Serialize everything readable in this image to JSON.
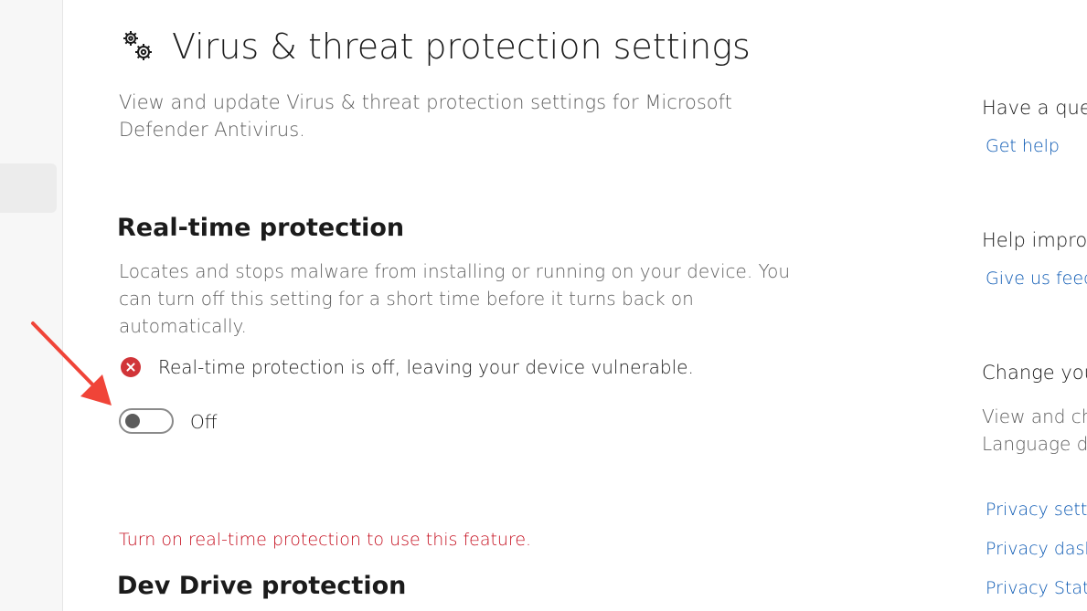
{
  "header": {
    "title": "Virus & threat protection settings",
    "description": "View and update Virus & threat protection settings for Microsoft Defender Antivirus.",
    "icon": "gears-icon"
  },
  "realtime": {
    "heading": "Real-time protection",
    "description": "Locates and stops malware from installing or running on your device. You can turn off this setting for a short time before it turns back on automatically.",
    "status_icon": "error-x-icon",
    "status_text": "Real-time protection is off, leaving your device vulnerable.",
    "toggle_state": "off",
    "toggle_label": "Off"
  },
  "warning": {
    "text": "Turn on real-time protection to use this feature."
  },
  "devdrive": {
    "heading": "Dev Drive protection"
  },
  "rail": {
    "question_heading": "Have a ques",
    "get_help": "Get help",
    "improve_heading": "Help improv",
    "feedback": "Give us feed",
    "privacy_heading": "Change you",
    "privacy_body": "View and ch for your Wi Language d",
    "privacy_settings": "Privacy setti",
    "privacy_dashboard": "Privacy dash",
    "privacy_statement": "Privacy State"
  },
  "colors": {
    "accent_link": "#0a58b3",
    "error": "#d13438",
    "warning_text": "#c50f1f",
    "annotation_arrow": "#f04438"
  }
}
